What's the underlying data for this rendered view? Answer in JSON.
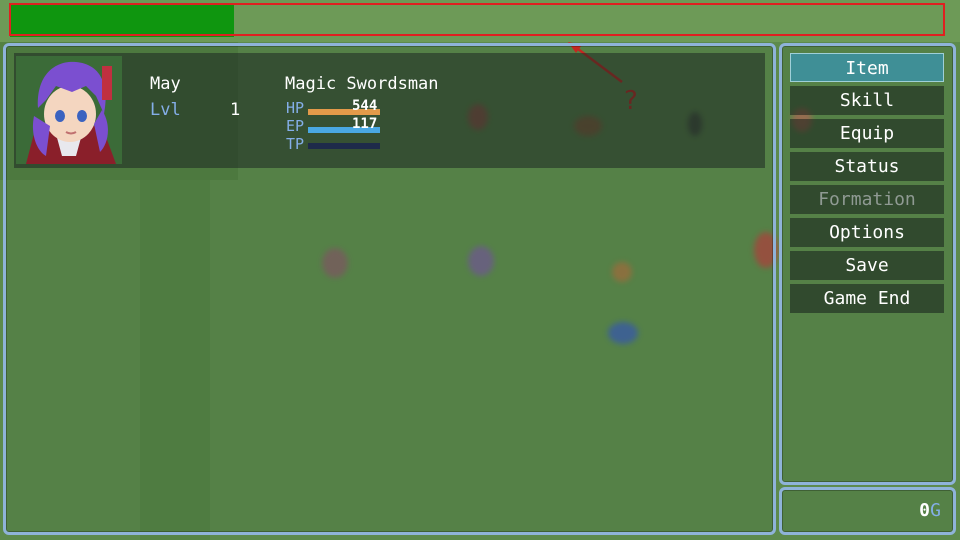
{
  "actor": {
    "name": "May",
    "class": "Magic Swordsman",
    "level_label": "Lvl",
    "level": "1",
    "hp_label": "HP",
    "hp": "544",
    "hp_fraction": 1.0,
    "ep_label": "EP",
    "ep": "117",
    "ep_fraction": 1.0,
    "tp_label": "TP",
    "tp_fraction": 0.0
  },
  "menu": {
    "items": [
      {
        "label": "Item",
        "state": "selected"
      },
      {
        "label": "Skill",
        "state": "enabled"
      },
      {
        "label": "Equip",
        "state": "enabled"
      },
      {
        "label": "Status",
        "state": "enabled"
      },
      {
        "label": "Formation",
        "state": "disabled"
      },
      {
        "label": "Options",
        "state": "enabled"
      },
      {
        "label": "Save",
        "state": "enabled"
      },
      {
        "label": "Game End",
        "state": "enabled"
      }
    ]
  },
  "gold": {
    "amount": "0",
    "unit": "G"
  },
  "annotation": {
    "mark": "?"
  },
  "colors": {
    "hp_gauge": "#e39a4a",
    "ep_gauge": "#4aa8e3",
    "tp_gauge": "#1e2a4a",
    "system_blue": "#84aee8",
    "annotation_red": "#e02020"
  }
}
